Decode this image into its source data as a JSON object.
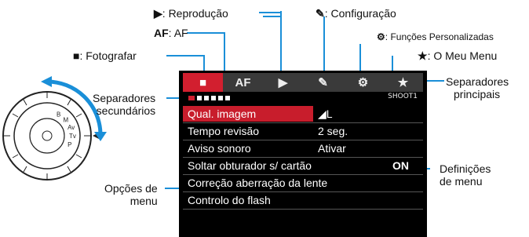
{
  "callouts": {
    "fotografar": "Fotografar",
    "af_symbol": "AF",
    "af": "AF",
    "reproducao": "Reprodução",
    "configuracao": "Configuração",
    "funcoes_personalizadas": "Funções Personalizadas",
    "meu_menu": "O Meu Menu",
    "separadores_principais": [
      "Separadores",
      "principais"
    ],
    "separadores_secundarios": [
      "Separadores",
      "secundários"
    ],
    "opcoes_de_menu": [
      "Opções de",
      "menu"
    ],
    "definicoes_de_menu": [
      "Definições",
      "de menu"
    ]
  },
  "screen": {
    "tabs": [
      {
        "icon": "camera-icon",
        "label": "",
        "active": true
      },
      {
        "icon": "af-icon",
        "label": "AF",
        "active": false
      },
      {
        "icon": "play-icon",
        "label": "",
        "active": false
      },
      {
        "icon": "wrench-icon",
        "label": "",
        "active": false
      },
      {
        "icon": "custom-functions-icon",
        "label": "",
        "active": false
      },
      {
        "icon": "star-icon",
        "label": "",
        "active": false
      }
    ],
    "subtab_count": 6,
    "subtab_active": 1,
    "page_id": "SHOOT1",
    "menu_items": [
      {
        "name": "Qual. imagem",
        "value": "◢L",
        "selected": true
      },
      {
        "name": "Tempo revisão",
        "value": "2 seg.",
        "selected": false
      },
      {
        "name": "Aviso sonoro",
        "value": "Ativar",
        "selected": false
      },
      {
        "name": "Soltar obturador s/ cartão",
        "value": "ON",
        "selected": false
      },
      {
        "name": "Correção aberração da lente",
        "value": "",
        "selected": false
      },
      {
        "name": "Controlo do flash",
        "value": "",
        "selected": false
      }
    ]
  },
  "dial": {
    "modes": [
      "B",
      "M",
      "Av",
      "Tv",
      "P"
    ]
  },
  "colors": {
    "accent_red": "#d21f2f",
    "callout_blue": "#1a8fd8"
  }
}
